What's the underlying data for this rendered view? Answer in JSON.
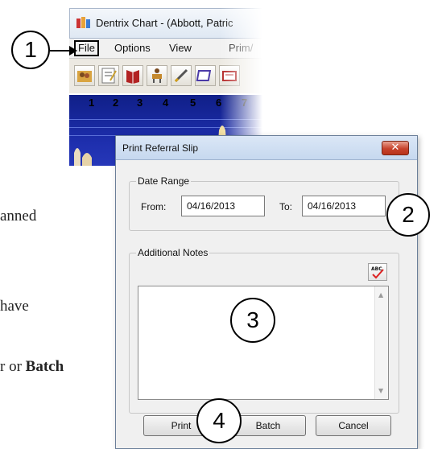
{
  "doc_text": {
    "line1": "anned",
    "line2": "have",
    "line3_prefix": "r or ",
    "line3_bold": "Batch"
  },
  "chart_window": {
    "title": "Dentrix Chart - (Abbott, Patric",
    "menu": {
      "file": "File",
      "options": "Options",
      "view": "View",
      "prim": "Prim/"
    },
    "toolbar_icons": [
      "family-file-icon",
      "notes-icon",
      "book-icon",
      "chair-icon",
      "pen-icon",
      "box-icon",
      "card-icon"
    ],
    "tooth_numbers": [
      "1",
      "2",
      "3",
      "4",
      "5",
      "6",
      "7"
    ]
  },
  "dialog": {
    "title": "Print Referral Slip",
    "close_glyph": "✕",
    "date_range": {
      "legend": "Date Range",
      "from_label": "From:",
      "from_value": "04/16/2013",
      "to_label": "To:",
      "to_value": "04/16/2013"
    },
    "notes": {
      "legend": "Additional Notes",
      "value": "",
      "spell_icon": "spell-check-icon",
      "spell_text": "ABC"
    },
    "buttons": {
      "print": "Print",
      "batch": "Batch",
      "cancel": "Cancel"
    }
  },
  "callouts": [
    "1",
    "2",
    "3",
    "4"
  ],
  "colors": {
    "chart_bg": "#1e2fae",
    "close_button": "#c7432c",
    "titlebar": "#c6d8ef"
  }
}
